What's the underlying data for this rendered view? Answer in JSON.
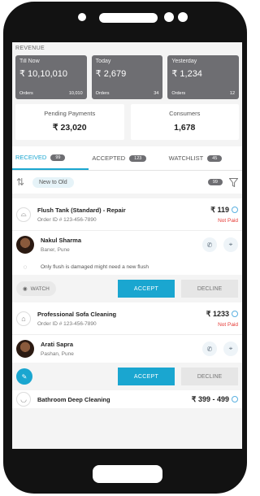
{
  "revenue": {
    "label": "REVENUE",
    "cards": [
      {
        "title": "Till Now",
        "value": "₹ 10,10,010",
        "orders_label": "Orders",
        "orders": "10,010"
      },
      {
        "title": "Today",
        "value": "₹ 2,679",
        "orders_label": "Orders",
        "orders": "34"
      },
      {
        "title": "Yesterday",
        "value": "₹ 1,234",
        "orders_label": "Orders",
        "orders": "12"
      }
    ]
  },
  "stats": {
    "pending": {
      "title": "Pending Payments",
      "value": "₹ 23,020"
    },
    "consumers": {
      "title": "Consumers",
      "value": "1,678"
    }
  },
  "tabs": [
    {
      "label": "RECEIVED",
      "count": "99"
    },
    {
      "label": "ACCEPTED",
      "count": "123"
    },
    {
      "label": "WATCHLIST",
      "count": "45"
    }
  ],
  "filter": {
    "sort_label": "New to Old",
    "count": "99"
  },
  "orders": [
    {
      "service": "Flush Tank (Standard) - Repair",
      "order_id": "Order ID # 123-456-7890",
      "price": "₹ 119",
      "status": "Not Paid",
      "customer": "Nakul Sharma",
      "location": "Baner, Pune",
      "note": "Only flush is damaged might need a new flush",
      "watch_label": "WATCH",
      "accept_label": "ACCEPT",
      "decline_label": "DECLINE"
    },
    {
      "service": "Professional Sofa Cleaning",
      "order_id": "Order ID # 123-456-7890",
      "price": "₹ 1233",
      "status": "Not Paid",
      "customer": "Arati Sapra",
      "location": "Pashan, Pune",
      "accept_label": "ACCEPT",
      "decline_label": "DECLINE"
    },
    {
      "service": "Bathroom Deep Cleaning",
      "price": "₹ 399 - 499"
    }
  ],
  "colors": {
    "accent": "#1aa6d0",
    "card_gray": "#6e6e72",
    "not_paid": "#e53935"
  }
}
